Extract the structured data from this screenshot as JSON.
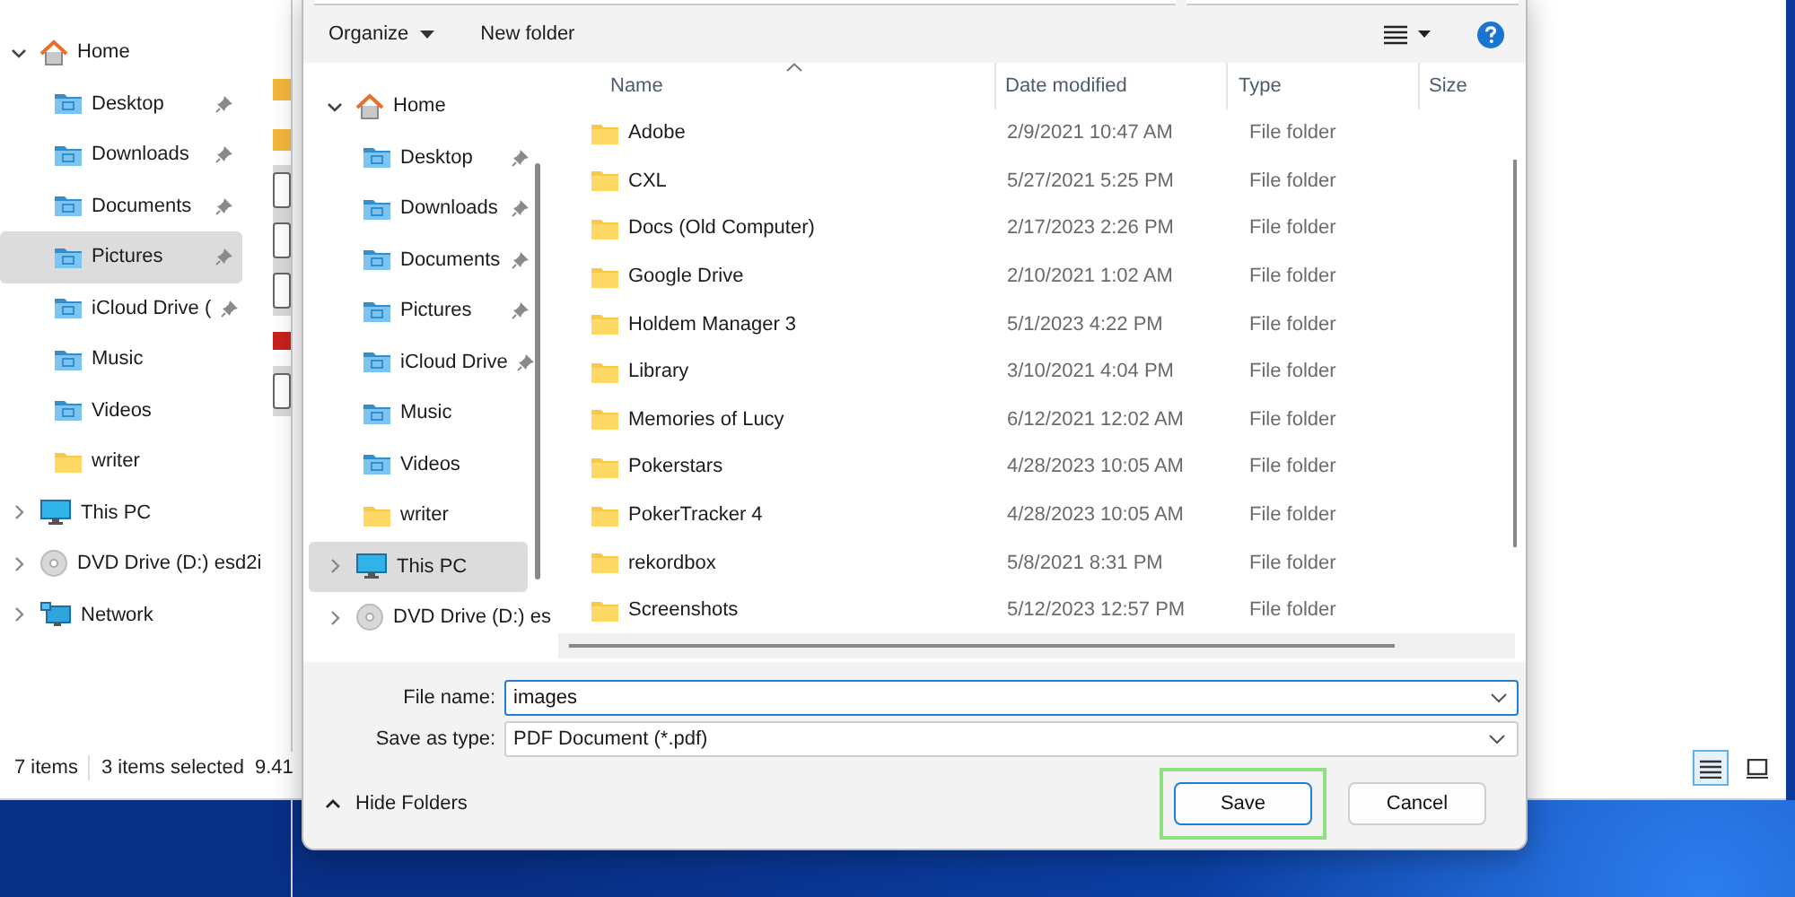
{
  "explorer": {
    "nav": [
      {
        "label": "Home",
        "kind": "home",
        "expanded": true,
        "selected": false,
        "children": [
          {
            "label": "Desktop",
            "kind": "desktop",
            "pinned": true,
            "selected": false
          },
          {
            "label": "Downloads",
            "kind": "downloads",
            "pinned": true,
            "selected": false
          },
          {
            "label": "Documents",
            "kind": "documents",
            "pinned": true,
            "selected": false
          },
          {
            "label": "Pictures",
            "kind": "pictures",
            "pinned": true,
            "selected": true
          },
          {
            "label": "iCloud Drive (",
            "kind": "cloud",
            "pinned": true,
            "selected": false
          },
          {
            "label": "Music",
            "kind": "music",
            "pinned": false,
            "selected": false
          },
          {
            "label": "Videos",
            "kind": "videos",
            "pinned": false,
            "selected": false
          },
          {
            "label": "writer",
            "kind": "folder",
            "pinned": false,
            "selected": false
          }
        ]
      },
      {
        "label": "This PC",
        "kind": "pc",
        "expanded": false,
        "selected": false
      },
      {
        "label": "DVD Drive (D:) esd2i",
        "kind": "dvd",
        "expanded": false,
        "selected": false
      },
      {
        "label": "Network",
        "kind": "network",
        "expanded": false,
        "selected": false
      }
    ],
    "status": [
      "7 items",
      "3 items selected",
      "9.41"
    ],
    "views": [
      {
        "kind": "details",
        "selected": true
      },
      {
        "kind": "tiles",
        "selected": false
      }
    ]
  },
  "dialog": {
    "toolbar": {
      "organize": "Organize",
      "new_folder": "New folder"
    },
    "nav": [
      {
        "label": "Home",
        "kind": "home",
        "expanded": true,
        "selected": false,
        "children": [
          {
            "label": "Desktop",
            "kind": "desktop",
            "pinned": true,
            "selected": false
          },
          {
            "label": "Downloads",
            "kind": "downloads",
            "pinned": true,
            "selected": false
          },
          {
            "label": "Documents",
            "kind": "documents",
            "pinned": true,
            "selected": false
          },
          {
            "label": "Pictures",
            "kind": "pictures",
            "pinned": true,
            "selected": false
          },
          {
            "label": "iCloud Drive",
            "kind": "cloud",
            "pinned": true,
            "selected": false
          },
          {
            "label": "Music",
            "kind": "music",
            "pinned": false,
            "selected": false
          },
          {
            "label": "Videos",
            "kind": "videos",
            "pinned": false,
            "selected": false
          },
          {
            "label": "writer",
            "kind": "folder",
            "pinned": false,
            "selected": false
          }
        ]
      },
      {
        "label": "This PC",
        "kind": "pc",
        "expanded": false,
        "selected": true
      },
      {
        "label": "DVD Drive (D:) es",
        "kind": "dvd",
        "expanded": false,
        "selected": false
      }
    ],
    "columns": [
      "Name",
      "Date modified",
      "Type",
      "Size"
    ],
    "rows": [
      {
        "name": "Adobe",
        "date": "2/9/2021 10:47 AM",
        "type": "File folder"
      },
      {
        "name": "CXL",
        "date": "5/27/2021 5:25 PM",
        "type": "File folder"
      },
      {
        "name": "Docs (Old Computer)",
        "date": "2/17/2023 2:26 PM",
        "type": "File folder"
      },
      {
        "name": "Google Drive",
        "date": "2/10/2021 1:02 AM",
        "type": "File folder"
      },
      {
        "name": "Holdem Manager 3",
        "date": "5/1/2023 4:22 PM",
        "type": "File folder"
      },
      {
        "name": "Library",
        "date": "3/10/2021 4:04 PM",
        "type": "File folder"
      },
      {
        "name": "Memories of Lucy",
        "date": "6/12/2021 12:02 AM",
        "type": "File folder"
      },
      {
        "name": "Pokerstars",
        "date": "4/28/2023 10:05 AM",
        "type": "File folder"
      },
      {
        "name": "PokerTracker 4",
        "date": "4/28/2023 10:05 AM",
        "type": "File folder"
      },
      {
        "name": "rekordbox",
        "date": "5/8/2021 8:31 PM",
        "type": "File folder"
      },
      {
        "name": "Screenshots",
        "date": "5/12/2023 12:57 PM",
        "type": "File folder"
      }
    ],
    "file_name_label": "File name:",
    "file_name": "images",
    "save_as_type_label": "Save as type:",
    "save_as_type": "PDF Document (*.pdf)",
    "hide_folders": "Hide Folders",
    "buttons": [
      {
        "label": "Save",
        "default": true,
        "highlighted": true
      },
      {
        "label": "Cancel",
        "default": false,
        "highlighted": false
      }
    ]
  }
}
